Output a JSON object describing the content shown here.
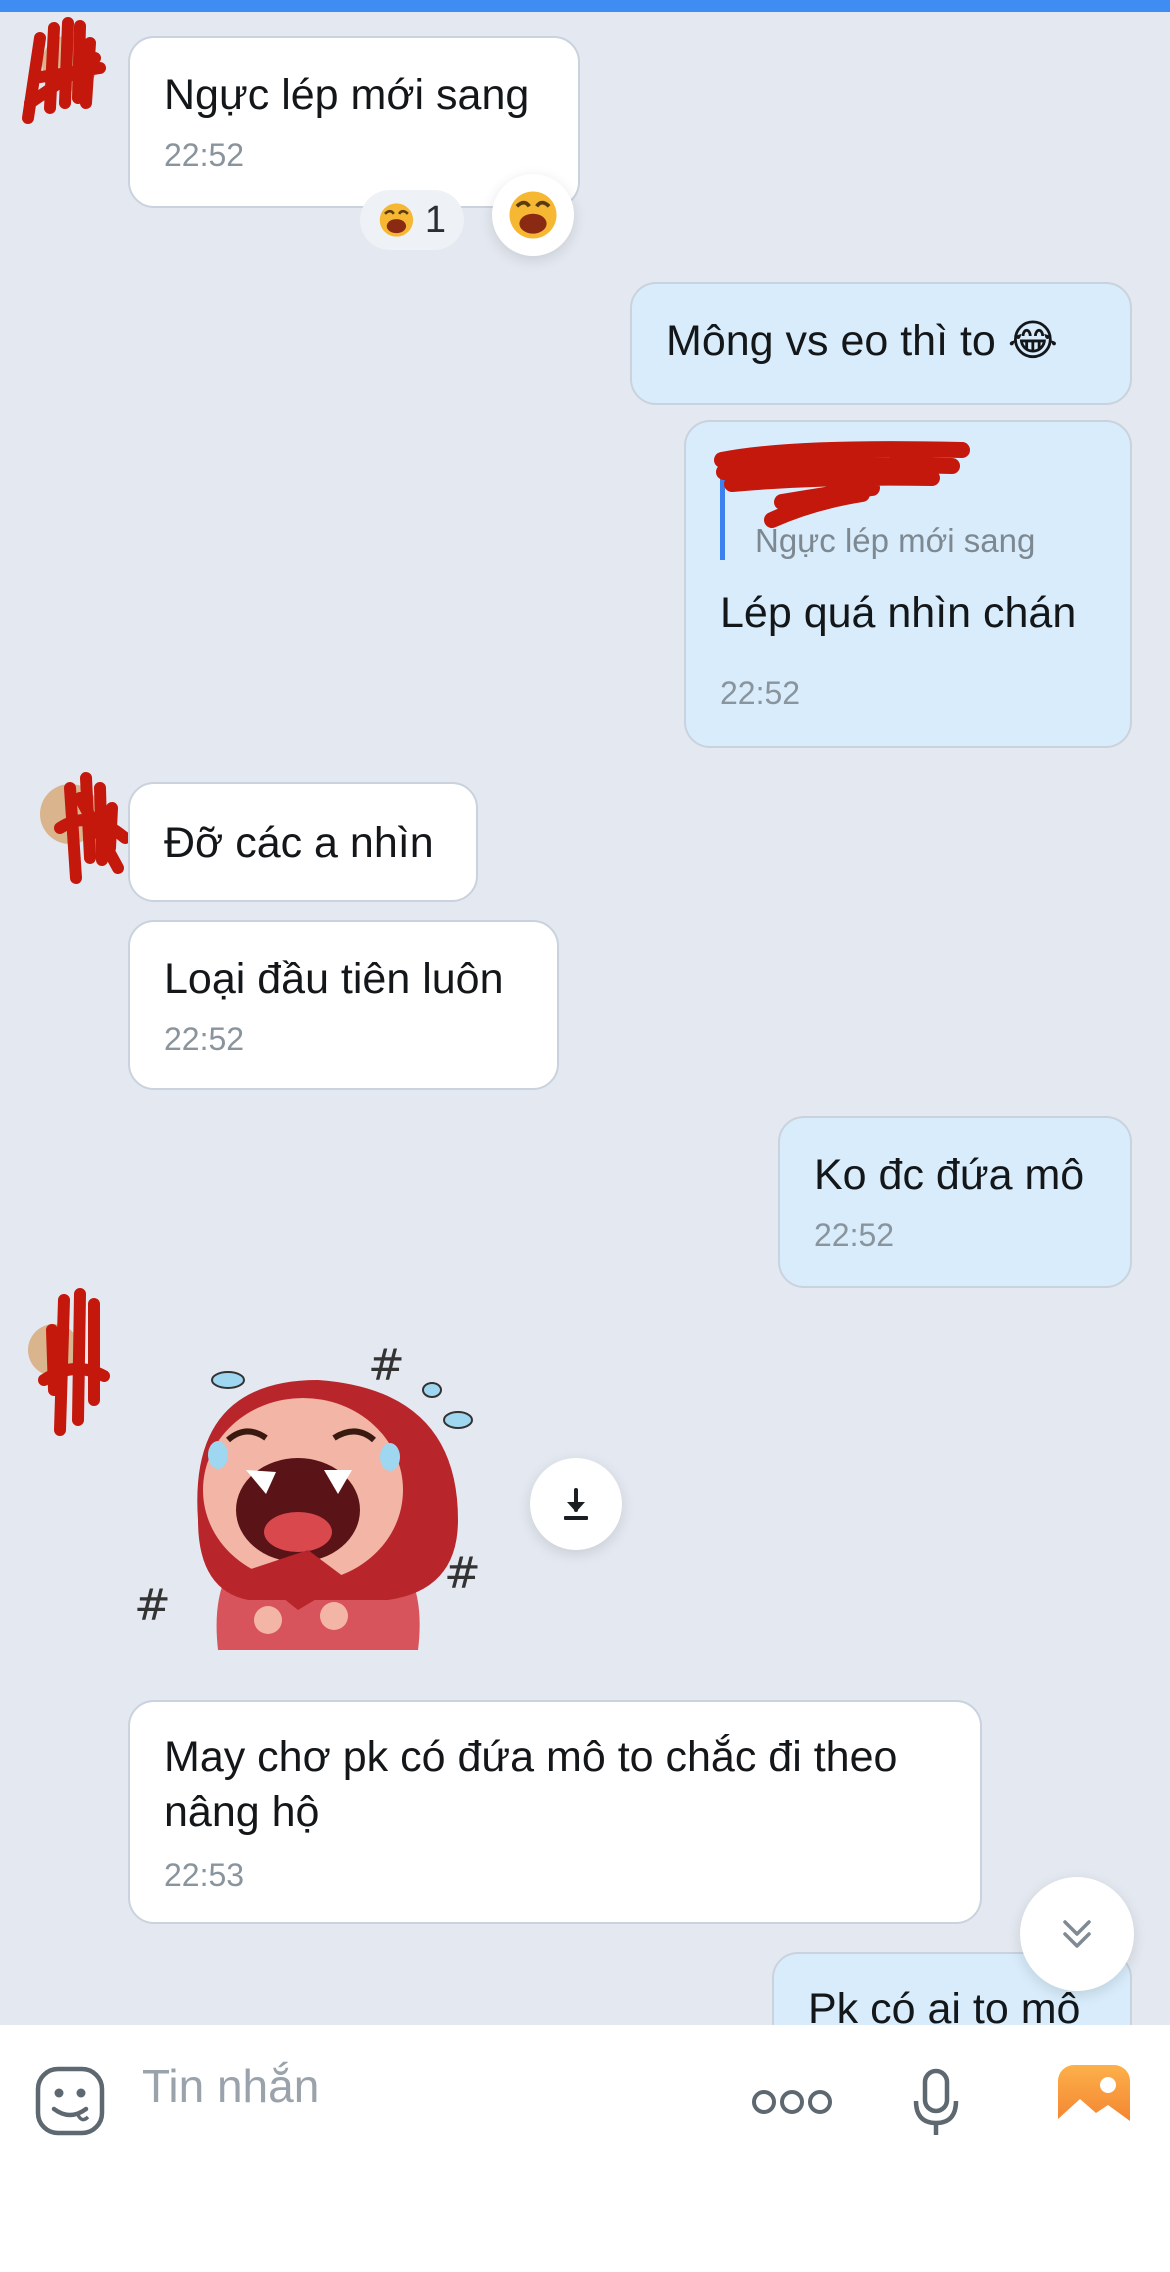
{
  "colors": {
    "background": "#e4e9f1",
    "incoming_bubble": "#ffffff",
    "outgoing_bubble": "#d8ecfb",
    "accent": "#3f8df2",
    "redaction": "#c4180c"
  },
  "messages": [
    {
      "id": "m1",
      "side": "incoming",
      "text": "Ngực lép mới sang",
      "time": "22:52",
      "reaction_count": "1",
      "reaction_icon": "laughing-emoji-icon"
    },
    {
      "id": "m2",
      "side": "outgoing",
      "text": "Mông vs eo thì to 😂"
    },
    {
      "id": "m3",
      "side": "outgoing",
      "reply_to": "Ngực lép mới sang",
      "text": "Lép quá nhìn chán",
      "time": "22:52"
    },
    {
      "id": "m4",
      "side": "incoming",
      "text": "Đỡ các a nhìn"
    },
    {
      "id": "m5",
      "side": "incoming",
      "text": "Loại đầu tiên luôn",
      "time": "22:52"
    },
    {
      "id": "m6",
      "side": "outgoing",
      "text": "Ko đc đứa mô",
      "time": "22:52"
    },
    {
      "id": "m7",
      "side": "incoming",
      "sticker": "crying-laughing-red-hood-girl-sticker"
    },
    {
      "id": "m8",
      "side": "incoming",
      "text": "May chơ pk có đứa mô to chắc đi theo nâng hộ",
      "time": "22:53"
    },
    {
      "id": "m9",
      "side": "outgoing",
      "text": "Pk có ai to mô"
    }
  ],
  "composer": {
    "placeholder": "Tin nhắn",
    "icons": [
      "sticker-icon",
      "more-icon",
      "microphone-icon",
      "gallery-icon"
    ]
  }
}
